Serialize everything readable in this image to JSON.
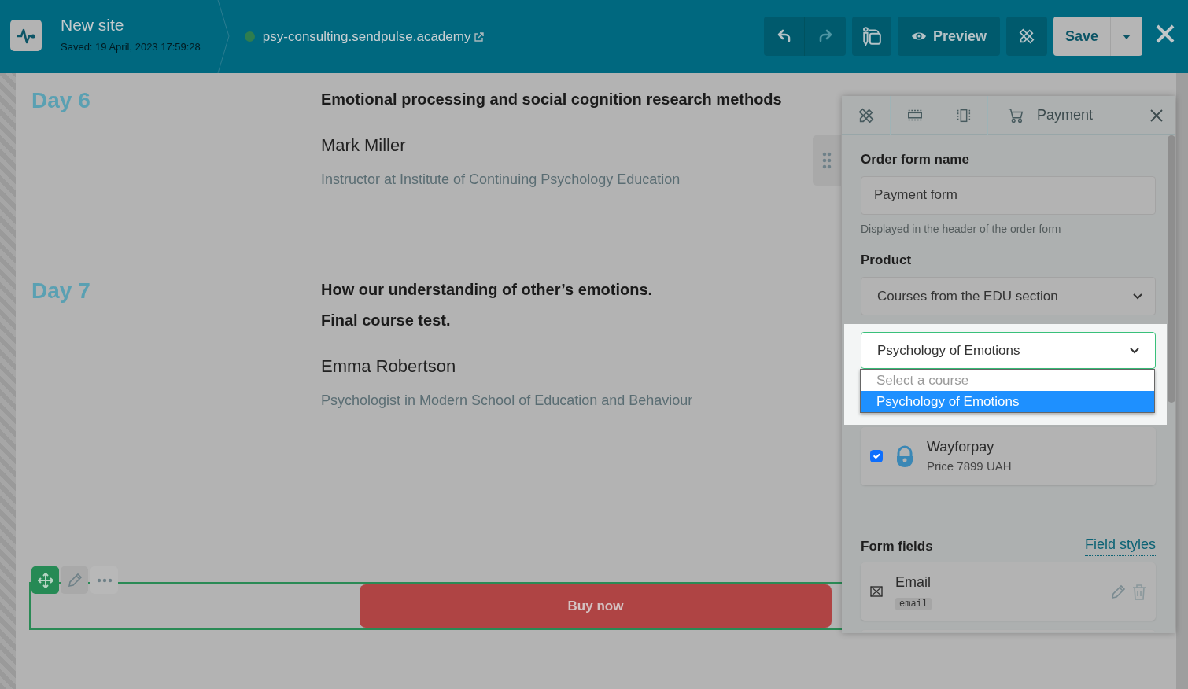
{
  "header": {
    "site_title": "New site",
    "saved": "Saved: 19 April, 2023 17:59:28",
    "domain": "psy-consulting.sendpulse.academy",
    "published": true,
    "buttons": [
      {
        "kind": "undo",
        "disabled": false
      },
      {
        "kind": "redo",
        "disabled": true
      },
      {
        "kind": "design"
      },
      {
        "kind": "preview",
        "label": "Preview"
      },
      {
        "kind": "tools"
      },
      {
        "kind": "save",
        "label": "Save"
      }
    ]
  },
  "days": [
    {
      "day": "Day 6",
      "title": [
        "Emotional processing and social cognition research methods"
      ],
      "name": "Mark Miller",
      "role": "Instructor at Institute of Continuing Psychology Education"
    },
    {
      "day": "Day 7",
      "title": [
        "How our understanding of other’s emotions.",
        "Final course test."
      ],
      "name": "Emma Robertson",
      "role": "Psychologist in Modern School of Education and Behaviour"
    }
  ],
  "buy_button": {
    "label": "Buy now"
  },
  "panel": {
    "breadcrumbs": [
      {
        "kind": "tools"
      },
      {
        "kind": "row"
      },
      {
        "kind": "column"
      },
      {
        "kind": "cart",
        "label": "Payment"
      }
    ],
    "order_form_label": "Order form name",
    "order_form_value": "Payment form",
    "order_form_hint": "Displayed in the header of the order form",
    "product_label": "Product",
    "product_value": "Courses from the EDU section",
    "course_value": "Psychology of Emotions",
    "course_options": [
      {
        "label": "Select a course",
        "selected": false,
        "disabled": true
      },
      {
        "label": "Psychology of Emotions",
        "selected": true,
        "disabled": false
      }
    ],
    "payment_methods": [
      {
        "name": "Wayforpay",
        "price": "Price 7899 UAH",
        "checked": true
      }
    ],
    "form_fields_label": "Form fields",
    "field_styles_link": "Field styles",
    "fields": [
      {
        "label": "Email",
        "code": "email"
      }
    ]
  }
}
